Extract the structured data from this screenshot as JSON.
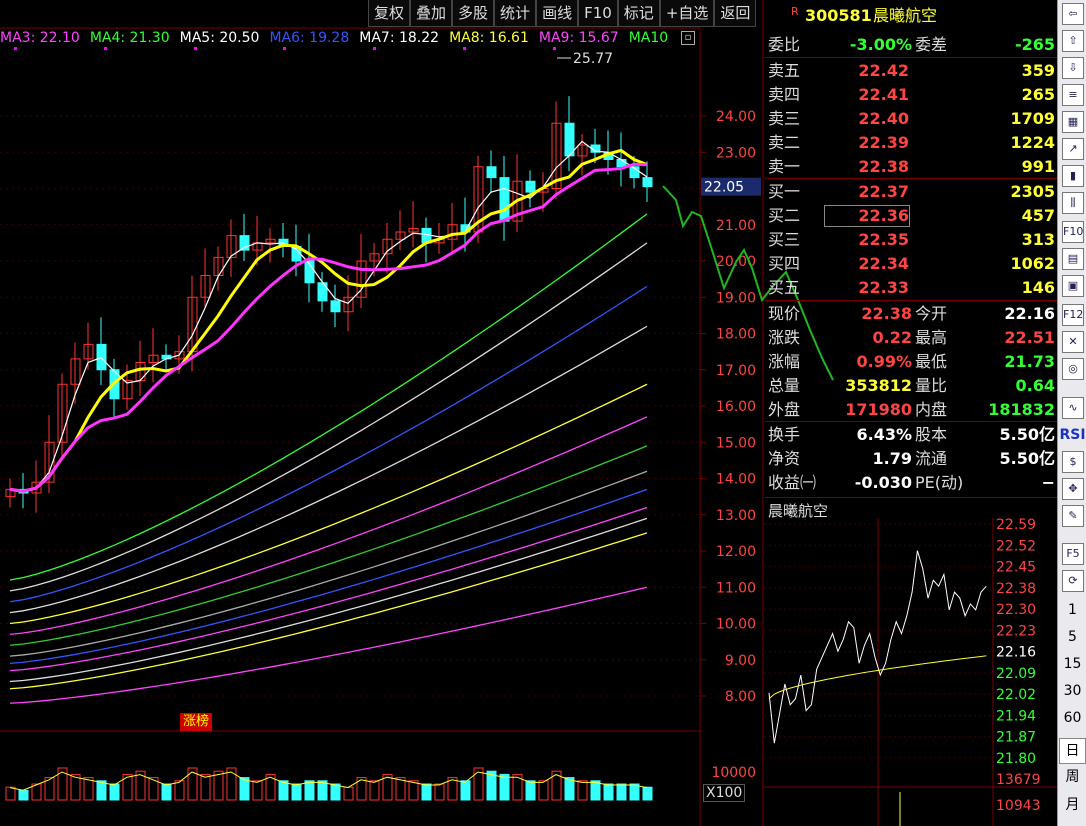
{
  "toolbar": [
    "复权",
    "叠加",
    "多股",
    "统计",
    "画线",
    "F10",
    "标记",
    "+自选",
    "返回"
  ],
  "ma_legend": [
    {
      "label": "MA3: 22.10",
      "color": "#ff44ff"
    },
    {
      "label": "MA4: 21.30",
      "color": "#33ff33"
    },
    {
      "label": "MA5: 20.50",
      "color": "#ffffff"
    },
    {
      "label": "MA6: 19.28",
      "color": "#3355ff"
    },
    {
      "label": "MA7: 18.22",
      "color": "#ffffff"
    },
    {
      "label": "MA8: 16.61",
      "color": "#ffff33"
    },
    {
      "label": "MA9: 15.67",
      "color": "#ff44ff"
    },
    {
      "label": "MA10",
      "color": "#33ff33"
    }
  ],
  "stock": {
    "badge": "R",
    "code": "300581",
    "name": "晨曦航空"
  },
  "quote": {
    "weibi": {
      "label": "委比",
      "value": "-3.00%",
      "label2": "委差",
      "value2": "-265"
    },
    "sell": [
      {
        "label": "卖五",
        "price": "22.42",
        "vol": "359"
      },
      {
        "label": "卖四",
        "price": "22.41",
        "vol": "265"
      },
      {
        "label": "卖三",
        "price": "22.40",
        "vol": "1709"
      },
      {
        "label": "卖二",
        "price": "22.39",
        "vol": "1224"
      },
      {
        "label": "卖一",
        "price": "22.38",
        "vol": "991"
      }
    ],
    "buy": [
      {
        "label": "买一",
        "price": "22.37",
        "vol": "2305"
      },
      {
        "label": "买二",
        "price": "22.36",
        "vol": "457"
      },
      {
        "label": "买三",
        "price": "22.35",
        "vol": "313"
      },
      {
        "label": "买四",
        "price": "22.34",
        "vol": "1062"
      },
      {
        "label": "买五",
        "price": "22.33",
        "vol": "146"
      }
    ],
    "stats": [
      {
        "l1": "现价",
        "v1": "22.38",
        "c1": "#ff4444",
        "l2": "今开",
        "v2": "22.16",
        "c2": "#ffffff"
      },
      {
        "l1": "涨跌",
        "v1": "0.22",
        "c1": "#ff4444",
        "l2": "最高",
        "v2": "22.51",
        "c2": "#ff4444"
      },
      {
        "l1": "涨幅",
        "v1": "0.99%",
        "c1": "#ff4444",
        "l2": "最低",
        "v2": "21.73",
        "c2": "#33ff33"
      },
      {
        "l1": "总量",
        "v1": "353812",
        "c1": "#ffff33",
        "l2": "量比",
        "v2": "0.64",
        "c2": "#33ff33"
      },
      {
        "l1": "外盘",
        "v1": "171980",
        "c1": "#ff4444",
        "l2": "内盘",
        "v2": "181832",
        "c2": "#33ff33"
      }
    ],
    "fund": [
      {
        "l1": "换手",
        "v1": "6.43%",
        "l2": "股本",
        "v2": "5.50亿"
      },
      {
        "l1": "净资",
        "v1": "1.79",
        "l2": "流通",
        "v2": "5.50亿"
      },
      {
        "l1": "收益㈠",
        "v1": "-0.030",
        "l2": "PE(动)",
        "v2": "−"
      }
    ]
  },
  "main_chart": {
    "y_ticks": [
      "24.00",
      "23.00",
      "22.00",
      "21.00",
      "20.00",
      "19.00",
      "18.00",
      "17.00",
      "16.00",
      "15.00",
      "14.00",
      "13.00",
      "12.00",
      "11.00",
      "10.00",
      "9.00",
      "8.00"
    ],
    "current_price_tag": "22.05",
    "peak_label": "25.77",
    "zhangbang": "涨榜",
    "vol_tick": "10000",
    "vol_unit": "X100"
  },
  "mini_chart": {
    "title": "晨曦航空",
    "y_ticks": [
      "22.59",
      "22.52",
      "22.45",
      "22.38",
      "22.30",
      "22.23",
      "22.16",
      "22.09",
      "22.02",
      "21.94",
      "21.87",
      "21.80"
    ],
    "vol_ticks": [
      "13679",
      "10943"
    ]
  },
  "side_toolbar": {
    "periods": [
      "1",
      "5",
      "15",
      "30",
      "60"
    ],
    "day": "日",
    "week": "周",
    "month": "月",
    "f5": "F5",
    "f10": "F10",
    "f12": "F12",
    "rsi": "RSI"
  },
  "colors": {
    "up": "#ff3333",
    "down": "#33ffff",
    "bg": "#000000",
    "grid": "#7a0000"
  }
}
